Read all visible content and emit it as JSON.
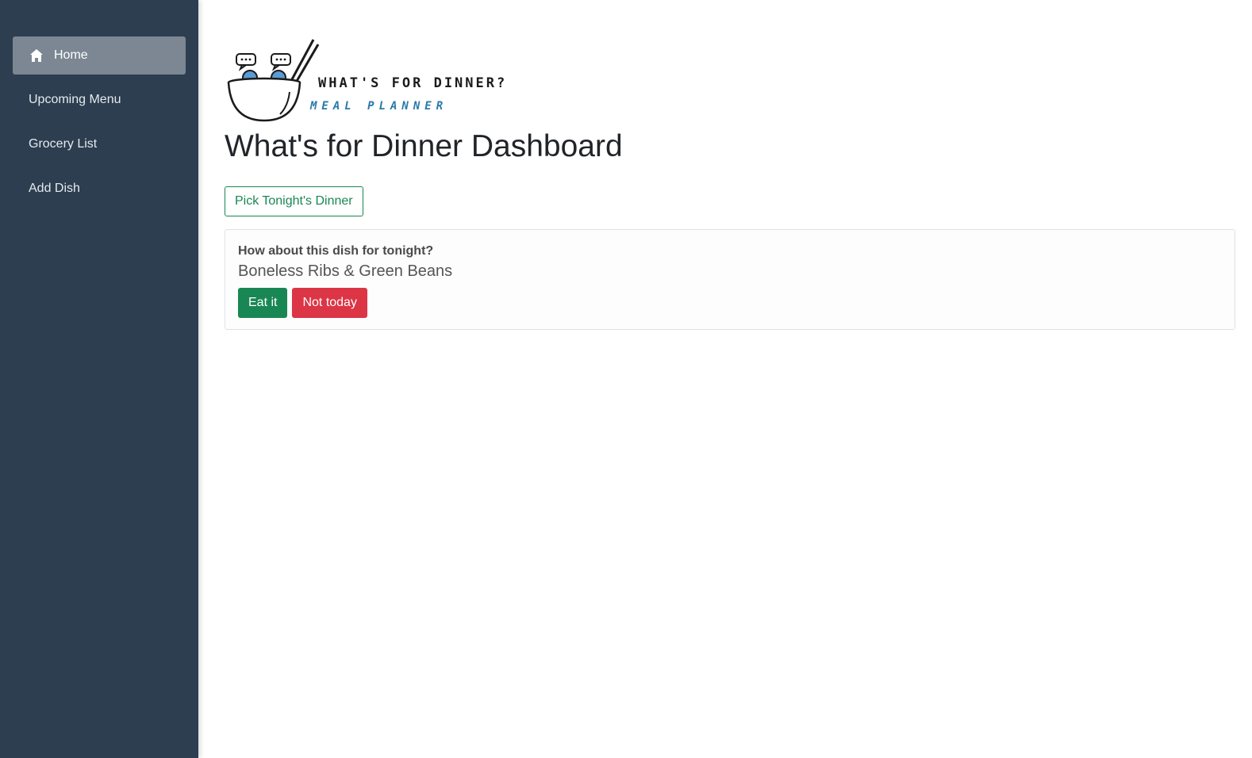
{
  "sidebar": {
    "items": [
      {
        "label": "Home",
        "icon": "home-icon",
        "active": true
      },
      {
        "label": "Upcoming Menu",
        "active": false
      },
      {
        "label": "Grocery List",
        "active": false
      },
      {
        "label": "Add Dish",
        "active": false
      }
    ]
  },
  "logo": {
    "title": "WHAT'S FOR DINNER?",
    "subtitle": "MEAL PLANNER"
  },
  "main": {
    "title": "What's for Dinner Dashboard",
    "pick_button_label": "Pick Tonight's Dinner",
    "suggestion": {
      "question": "How about this dish for tonight?",
      "dish": "Boneless Ribs & Green Beans",
      "accept_label": "Eat it",
      "reject_label": "Not today"
    }
  },
  "colors": {
    "sidebar_bg": "#2c3e50",
    "active_item_bg": "#7c8793",
    "success": "#198754",
    "danger": "#dc3545",
    "logo_accent": "#2a7aa8"
  }
}
